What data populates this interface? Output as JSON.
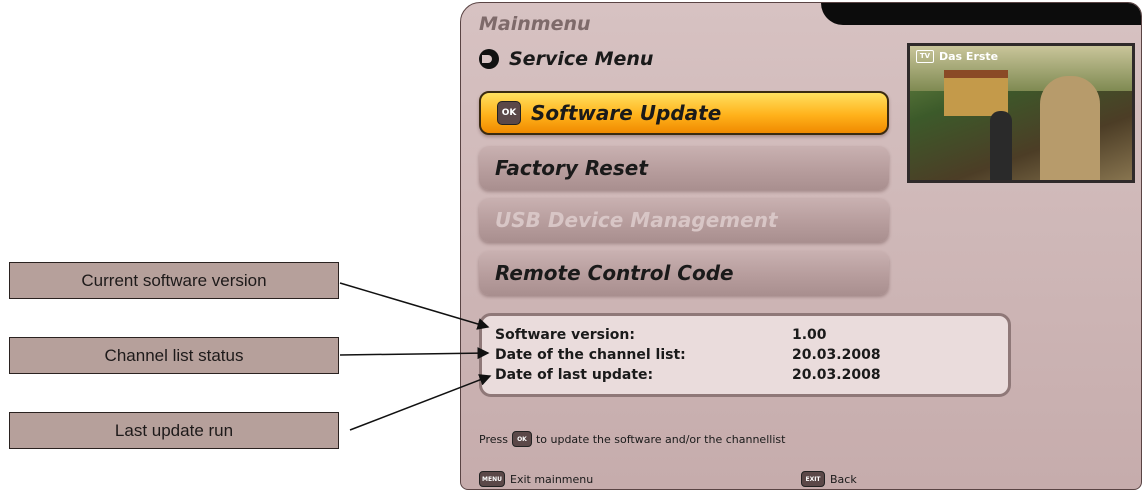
{
  "callouts": {
    "current_software_version": "Current software version",
    "channel_list_status": "Channel list status",
    "last_update_run": "Last update run"
  },
  "osd": {
    "title": "Mainmenu",
    "subtitle": "Service Menu",
    "preview_channel": "Das Erste",
    "preview_icon": "tv-icon",
    "menu": [
      {
        "label": "Software Update",
        "state": "selected",
        "key": "OK"
      },
      {
        "label": "Factory Reset",
        "state": "normal"
      },
      {
        "label": "USB Device Management",
        "state": "disabled"
      },
      {
        "label": "Remote Control Code",
        "state": "normal"
      }
    ],
    "info": [
      {
        "label": "Software version:",
        "value": "1.00"
      },
      {
        "label": "Date of the channel list:",
        "value": "20.03.2008"
      },
      {
        "label": "Date of last update:",
        "value": "20.03.2008"
      }
    ],
    "hint_before": "Press",
    "hint_key": "OK",
    "hint_after": "to update the software and/or the channellist",
    "footer": [
      {
        "key": "MENU",
        "label": "Exit mainmenu"
      },
      {
        "key": "EXIT",
        "label": "Back"
      }
    ]
  },
  "colors": {
    "selected": "#ffb21b",
    "panel": "#d0b8b8",
    "callout": "#b6a09b"
  }
}
